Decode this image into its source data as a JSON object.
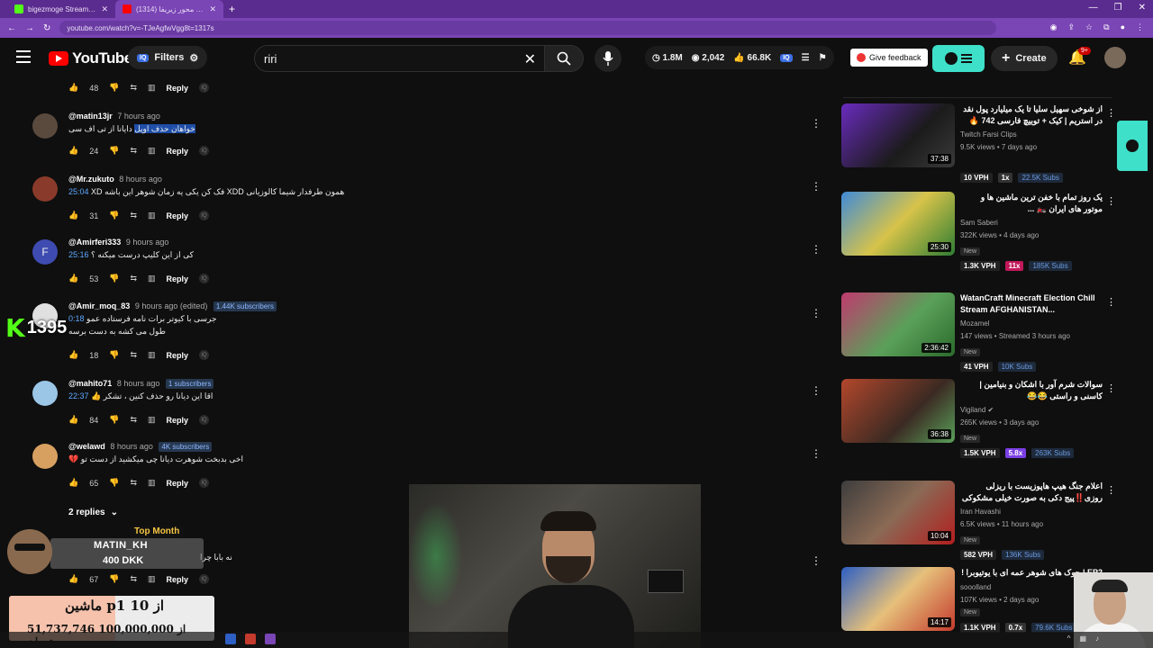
{
  "browser": {
    "tabs": [
      {
        "title": "bigezmoge Stream - Watch Live",
        "fav_color": "#53fc18"
      },
      {
        "title": "(1314) واکنش به محور زیریفا",
        "fav_color": "#ff0000"
      }
    ],
    "url": "youtube.com/watch?v=-TJeAgfwVgg8t=1317s"
  },
  "header": {
    "logo_text": "YouTube",
    "filters_label": "Filters",
    "search_value": "riri",
    "stats": {
      "views": "1.8M",
      "watching": "2,042",
      "likes": "66.8K"
    },
    "feedback_label": "Give feedback",
    "create_label": "Create",
    "notif_count": "9+"
  },
  "comments": [
    {
      "likes": "48"
    },
    {
      "user": "@matin13jr",
      "time": "7 hours ago",
      "text_pre": "",
      "text_hl": "خواهان حذف اوپل",
      "text_post": " دایانا از تی اف سی",
      "likes": "24",
      "avatar_color": "#5a4a3e"
    },
    {
      "user": "@Mr.zukuto",
      "time": "8 hours ago",
      "ts": "25:04",
      "text": " همون طرفدار شیما کالوزیانی XDD فک کن یکی یه زمان شوهر این باشه XD",
      "likes": "31",
      "avatar_color": "#8a3a2a"
    },
    {
      "user": "@Amirferi333",
      "time": "9 hours ago",
      "ts": "25:16",
      "text": " کی از این کلیپ درست میکنه ؟",
      "likes": "53",
      "avatar_letter": "F",
      "avatar_color": "#3e4bb0"
    },
    {
      "user": "@Amir_moq_83",
      "time": "9 hours ago (edited)",
      "subs": "1.44K subscribers",
      "ts": "0:18",
      "text": " جرسی با کیوتر برات نامه فرستاده عمو",
      "text2": "طول می کشه به دست برسه",
      "likes": "18",
      "avatar_color": "#e0e0e0"
    },
    {
      "user": "@mahito71",
      "time": "8 hours ago",
      "subs": "1 subscribers",
      "ts": "22:37",
      "text": " اقا این دیانا رو حذف کنین ، تشکر 👍",
      "likes": "84",
      "avatar_color": "#9bc6e6"
    },
    {
      "user": "@welawd",
      "time": "8 hours ago",
      "subs": "4K subscribers",
      "text": "اخی بدبخت شوهرت دیانا چی میکشید از دست تو 💔",
      "likes": "65",
      "avatar_color": "#d8a060"
    },
    {
      "text": "نه بابا چرا",
      "likes": "67"
    }
  ],
  "replies_label": "2 replies",
  "reply_label": "Reply",
  "sidebar": [
    {
      "title": "از شوخی سهیل سلیا تا یک میلیارد پول نقد در استریم | کیک + توییچ فارسی 742 🔥",
      "channel": "Twitch Farsi Clips",
      "meta": "9.5K views • 7 days ago",
      "duration": "37:38",
      "vph": "10 VPH",
      "mult": "1x",
      "subs": "22.5K Subs",
      "mult_color": "#333333",
      "thumb": "#6a2bbf",
      "new": ""
    },
    {
      "title": "یک روز تمام با خفن ترین ماشین ها و موتور های ایران 🏍️ ...",
      "channel": "Sam Saberi",
      "meta": "322K views • 4 days ago",
      "duration": "25:30",
      "vph": "1.3K VPH",
      "mult": "11x",
      "subs": "185K Subs",
      "mult_color": "#c2185b",
      "thumb": "#d7c34a",
      "new": "New"
    },
    {
      "title": "WatanCraft Minecraft Election Chill Stream AFGHANISTAN...",
      "channel": "Mozamel",
      "meta": "147 views • Streamed 3 hours ago",
      "duration": "2:36:42",
      "vph": "41 VPH",
      "mult": "",
      "subs": "10K Subs",
      "mult_color": "",
      "thumb": "#c03a6e",
      "new": "New"
    },
    {
      "title": "سوالات شرم آور با اشکان و بنیامین | کاسنی و راستی 😂😂",
      "channel": "Vigiland ✔",
      "meta": "265K views • 3 days ago",
      "duration": "36:38",
      "vph": "1.5K VPH",
      "mult": "5.8x",
      "subs": "263K Subs",
      "mult_color": "#7b3fe4",
      "thumb": "#b3472c",
      "new": "New"
    },
    {
      "title": "اعلام جنگ هیپ هاپوزیست با ریزلی روزی‼️پیج دکی به صورت خیلی مشکوکی",
      "channel": "Iran Havashi",
      "meta": "6.5K views • 11 hours ago",
      "duration": "10:04",
      "vph": "582 VPH",
      "mult": "",
      "subs": "136K Subs",
      "mult_color": "",
      "thumb": "#3d3d3d",
      "new": "New"
    },
    {
      "title": "EP2 | جوک های شوهر عمه ای با یوتیوبرا !",
      "channel": "sooolland",
      "meta": "107K views • 2 days ago",
      "duration": "14:17",
      "vph": "1.1K VPH",
      "mult": "0.7x",
      "subs": "79.6K Subs",
      "mult_color": "#333333",
      "thumb": "#2d5fc4",
      "new": "New"
    }
  ],
  "overlays": {
    "kick_count": "1395",
    "top_month_label": "Top Month",
    "top_donor": "MATIN_KH",
    "top_amount": "400 DKK",
    "goal_line1": "ماشین p1 از 10",
    "goal_line2": "51,737,746 از 100,000,000 تومان",
    "goal_fraction": 0.517
  }
}
